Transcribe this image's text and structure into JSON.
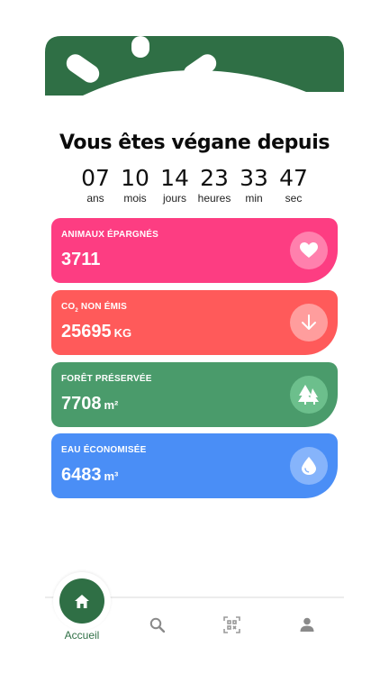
{
  "title": "Vous êtes végane depuis",
  "counter": [
    {
      "value": "07",
      "unit": "ans"
    },
    {
      "value": "10",
      "unit": "mois"
    },
    {
      "value": "14",
      "unit": "jours"
    },
    {
      "value": "23",
      "unit": "heures"
    },
    {
      "value": "33",
      "unit": "min"
    },
    {
      "value": "47",
      "unit": "sec"
    }
  ],
  "cards": {
    "animals": {
      "label": "ANIMAUX ÉPARGNÉS",
      "value": "3711",
      "unit": "",
      "icon": "heart-icon",
      "color": "#fd3d82"
    },
    "co2": {
      "label_prefix": "CO",
      "label_sub": "2",
      "label_suffix": " NON ÉMIS",
      "value": "25695",
      "unit": "KG",
      "icon": "arrow-down-icon",
      "color": "#ff5a5a"
    },
    "forest": {
      "label": "FORÊT PRÉSERVÉE",
      "value": "7708",
      "unit": "m²",
      "icon": "trees-icon",
      "color": "#4a9b6b"
    },
    "water": {
      "label": "EAU ÉCONOMISÉE",
      "value": "6483",
      "unit": "m³",
      "icon": "water-drop-icon",
      "color": "#4a8ef6"
    }
  },
  "nav": {
    "home_label": "Accueil",
    "items": [
      "home-icon",
      "search-icon",
      "qr-code-icon",
      "profile-icon"
    ],
    "accent": "#2f6f45"
  }
}
